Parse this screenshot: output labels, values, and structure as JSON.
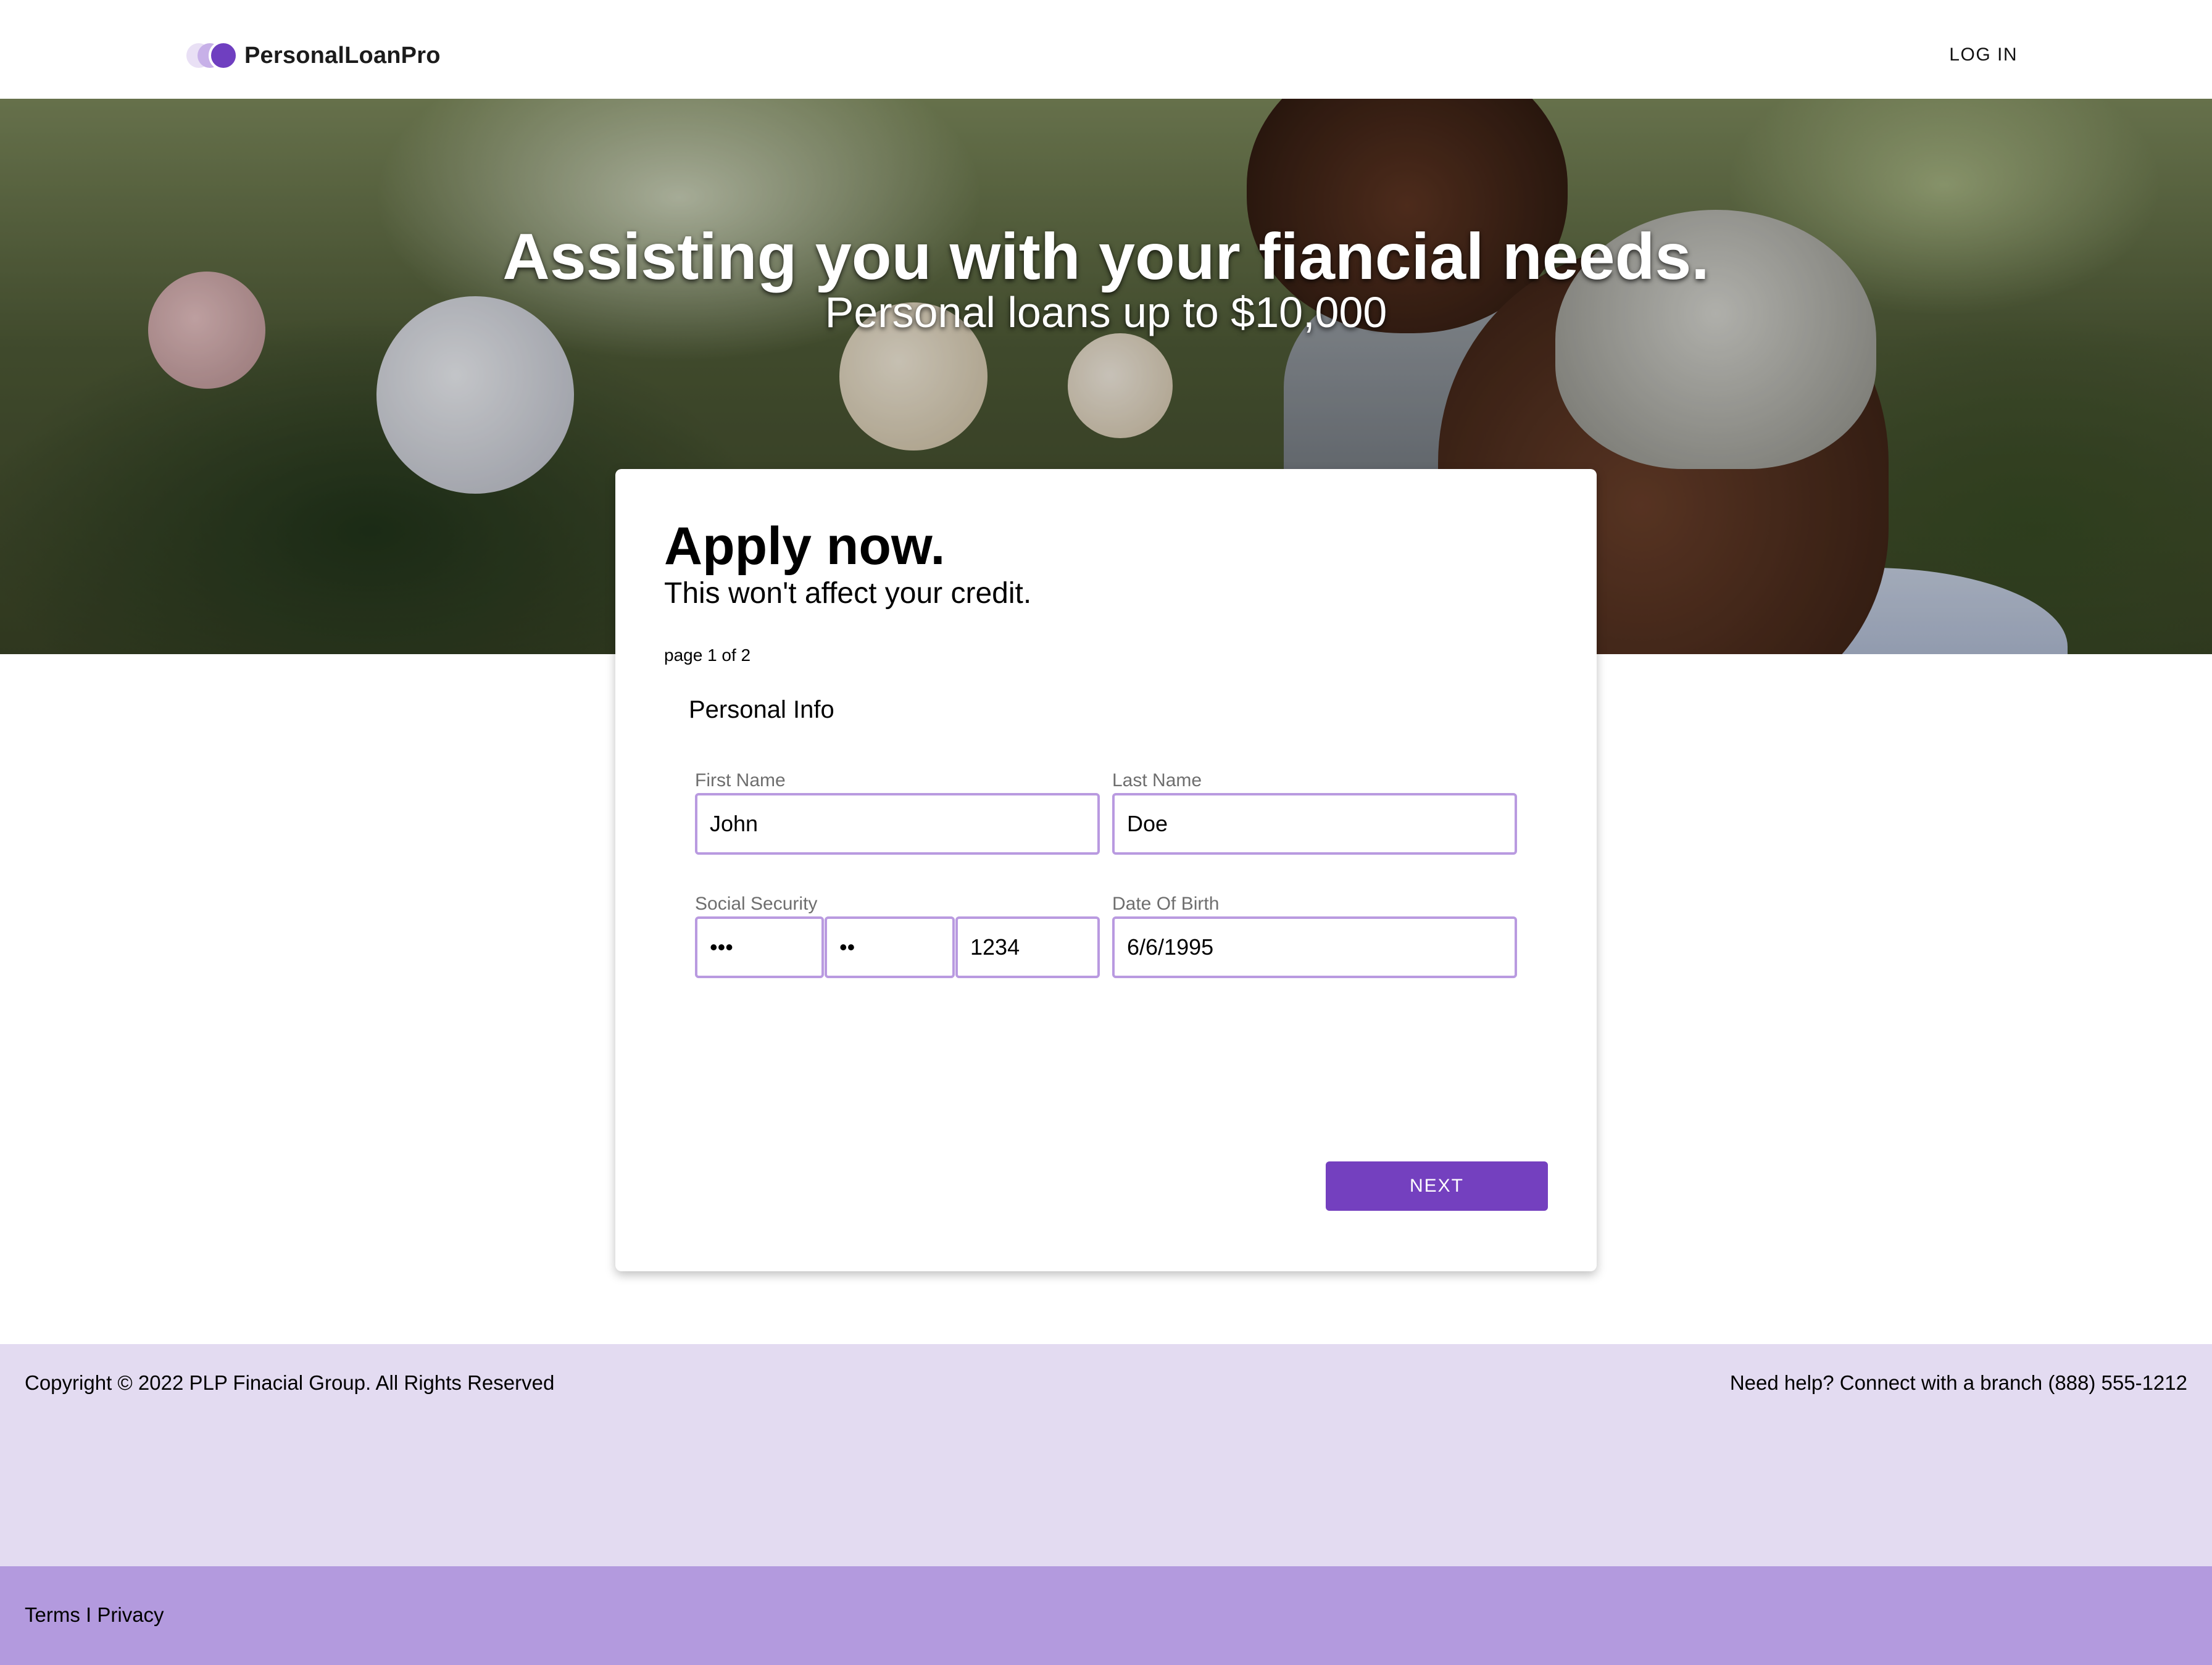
{
  "header": {
    "brand": "PersonalLoanPro",
    "login_label": "LOG IN"
  },
  "hero": {
    "title": "Assisting you with your fiancial needs.",
    "subtitle": "Personal loans up to $10,000"
  },
  "form": {
    "title": "Apply now.",
    "subtitle": "This won't affect your credit.",
    "page_indicator": "page 1 of 2",
    "section_title": "Personal Info",
    "first_name": {
      "label": "First Name",
      "value": "John"
    },
    "last_name": {
      "label": "Last Name",
      "value": "Doe"
    },
    "ssn": {
      "label": "Social Security",
      "part1": "•••",
      "part2": "••",
      "part3": "1234"
    },
    "dob": {
      "label": "Date Of Birth",
      "value": "6/6/1995"
    },
    "next_label": "NEXT"
  },
  "footer": {
    "copyright": "Copyright © 2022 PLP Finacial Group. All Rights Reserved",
    "help": "Need help? Connect with a branch (888) 555-1212",
    "terms": "Terms",
    "separator": "I",
    "privacy": "Privacy"
  },
  "colors": {
    "accent": "#7440bf",
    "input_border": "#b99ae0",
    "footer_light": "#e3dbf1",
    "footer_dark": "#b39ade"
  },
  "icons": {
    "logo": "logo-icon"
  }
}
